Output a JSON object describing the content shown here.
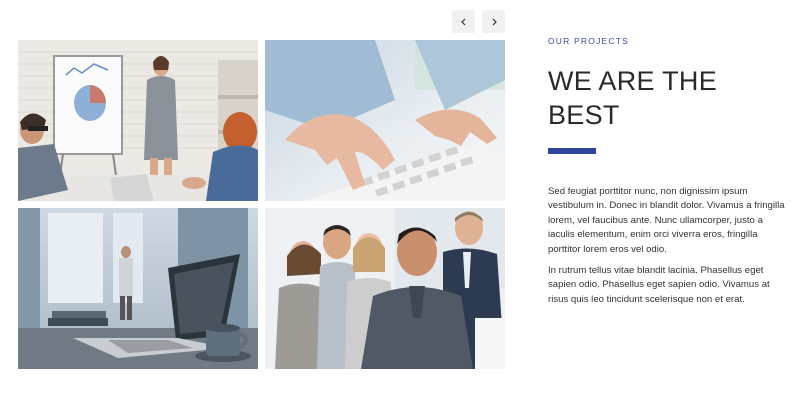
{
  "carousel": {
    "prev_icon": "chevron-left-icon",
    "next_icon": "chevron-right-icon"
  },
  "gallery": {
    "tiles": [
      {
        "name": "office-presentation-photo"
      },
      {
        "name": "typing-keyboard-photo"
      },
      {
        "name": "laptop-office-photo"
      },
      {
        "name": "business-team-photo"
      }
    ]
  },
  "section": {
    "eyebrow": "OUR PROJECTS",
    "heading_line1": "WE ARE THE",
    "heading_line2": "BEST",
    "paragraph1": "Sed feugiat porttitor nunc, non dignissim ipsum vestibulum in. Donec in blandit dolor. Vivamus a fringilla lorem, vel faucibus ante. Nunc ullamcorper, justo a iaculis elementum, enim orci viverra eros, fringilla porttitor lorem eros vel odio.",
    "paragraph2": "In rutrum tellus vitae blandit lacinia. Phasellus eget sapien odio. Phasellus eget sapien odio. Vivamus at risus quis leo tincidunt scelerisque non et erat."
  },
  "colors": {
    "accent": "#2f45a0",
    "eyebrow": "#3b4a9a",
    "heading": "#2a2a2a",
    "body_text": "#333333",
    "nav_button_bg": "#f1f1f1"
  }
}
